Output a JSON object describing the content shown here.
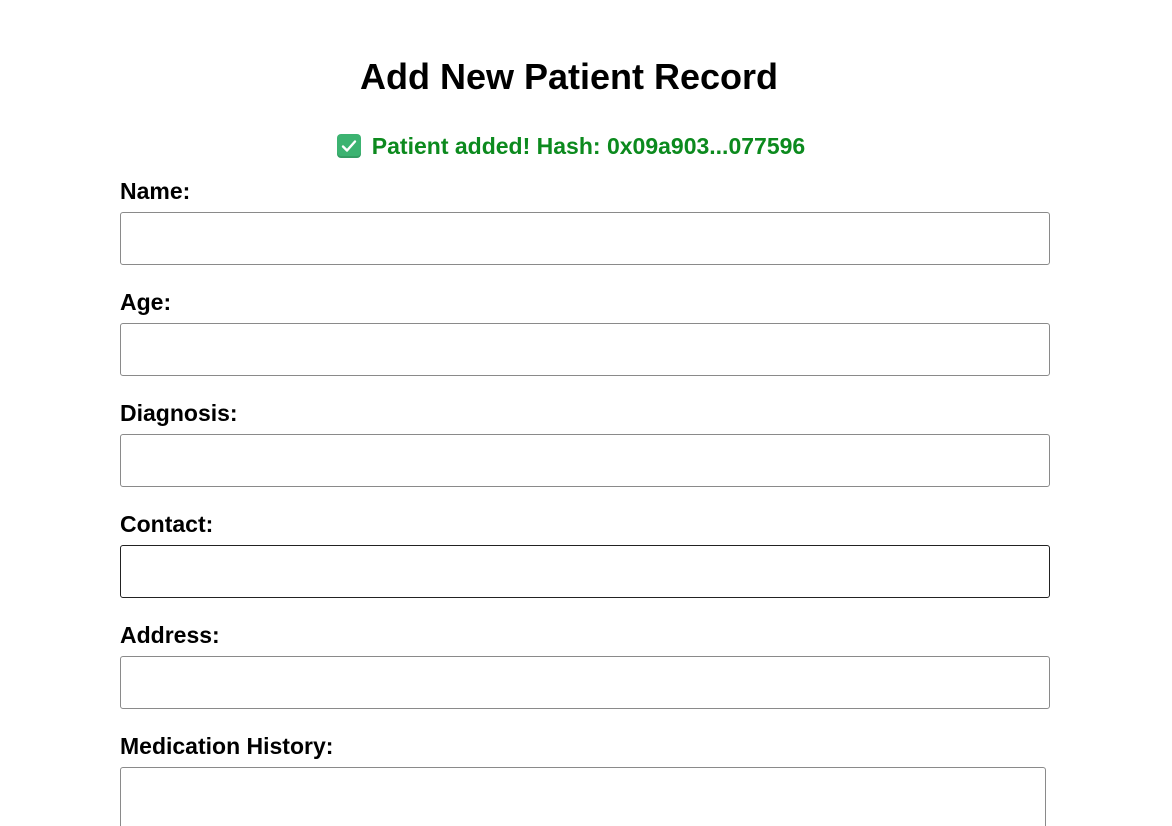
{
  "page": {
    "title": "Add New Patient Record"
  },
  "status": {
    "icon": "check-mark-icon",
    "message": "Patient added! Hash: 0x09a903...077596",
    "color": "#0c8a1e"
  },
  "form": {
    "fields": [
      {
        "label": "Name:",
        "value": ""
      },
      {
        "label": "Age:",
        "value": ""
      },
      {
        "label": "Diagnosis:",
        "value": ""
      },
      {
        "label": "Contact:",
        "value": ""
      },
      {
        "label": "Address:",
        "value": ""
      },
      {
        "label": "Medication History:",
        "value": ""
      }
    ]
  }
}
